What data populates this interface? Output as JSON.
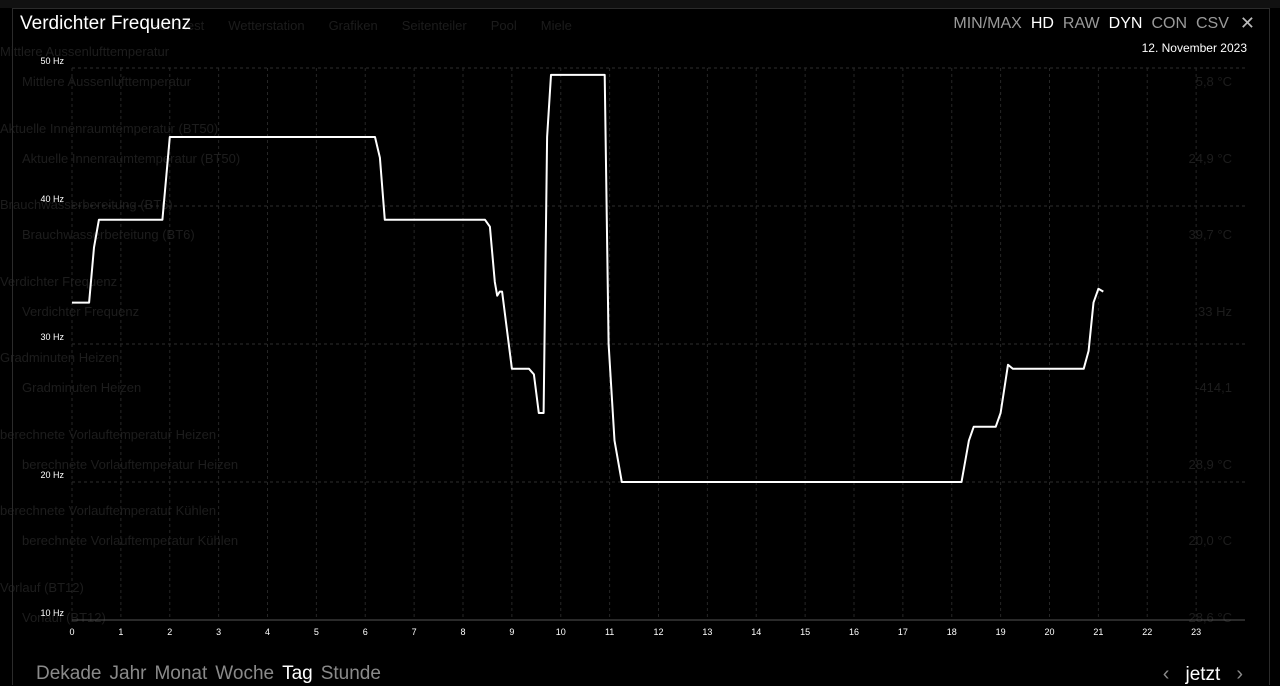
{
  "background": {
    "tabs": [
      "Hello test",
      "Wetterstation",
      "Grafiken",
      "Seitenteiler",
      "Pool",
      "Miele"
    ],
    "rows": [
      {
        "title": "Mittlere Aussenlufttemperatur",
        "label": "Mittlere Aussenlufttemperatur",
        "value": "5,8 °C"
      },
      {
        "title": "Aktuelle Innenraumtemperatur (BT50)",
        "label": "Aktuelle Innenraumtemperatur (BT50)",
        "value": "24,9 °C"
      },
      {
        "title": "Brauchwasserbereitung (BT6)",
        "label": "Brauchwasserbereitung (BT6)",
        "value": "39,7 °C"
      },
      {
        "title": "Verdichter Frequenz",
        "label": "Verdichter Frequenz",
        "value": "33 Hz"
      },
      {
        "title": "Gradminuten Heizen",
        "label": "Gradminuten Heizen",
        "value": "-414,1"
      },
      {
        "title": "berechnete Vorlauftemperatur Heizen",
        "label": "berechnete Vorlauftemperatur Heizen",
        "value": "28,9 °C"
      },
      {
        "title": "berechnete Vorlauftemperatur Kühlen",
        "label": "berechnete Vorlauftemperatur Kühlen",
        "value": "20,0 °C"
      },
      {
        "title": "Vorlauf (BT12)",
        "label": "Vorlauf (BT12)",
        "value": "28,6 °C"
      }
    ]
  },
  "modal": {
    "title": "Verdichter Frequenz",
    "date": "12. November 2023",
    "toolbar": [
      {
        "label": "MIN/MAX",
        "active": false
      },
      {
        "label": "HD",
        "active": true
      },
      {
        "label": "RAW",
        "active": false
      },
      {
        "label": "DYN",
        "active": true
      },
      {
        "label": "CON",
        "active": false
      },
      {
        "label": "CSV",
        "active": false
      }
    ],
    "close_icon": "close-icon",
    "ranges": [
      {
        "label": "Dekade",
        "active": false
      },
      {
        "label": "Jahr",
        "active": false
      },
      {
        "label": "Monat",
        "active": false
      },
      {
        "label": "Woche",
        "active": false
      },
      {
        "label": "Tag",
        "active": true
      },
      {
        "label": "Stunde",
        "active": false
      }
    ],
    "nav": {
      "prev_icon": "chevron-left-icon",
      "now_label": "jetzt",
      "next_icon": "chevron-right-icon"
    }
  },
  "chart_data": {
    "type": "line",
    "title": "Verdichter Frequenz",
    "xlabel": "",
    "ylabel": "",
    "xlim": [
      0,
      24
    ],
    "ylim": [
      10,
      50
    ],
    "x_ticks": [
      "0",
      "1",
      "2",
      "3",
      "4",
      "5",
      "6",
      "7",
      "8",
      "9",
      "10",
      "11",
      "12",
      "13",
      "14",
      "15",
      "16",
      "17",
      "18",
      "19",
      "20",
      "21",
      "22",
      "23"
    ],
    "y_ticks": [
      {
        "value": 10,
        "label": "10 Hz"
      },
      {
        "value": 20,
        "label": "20 Hz"
      },
      {
        "value": 30,
        "label": "30 Hz"
      },
      {
        "value": 40,
        "label": "40 Hz"
      },
      {
        "value": 50,
        "label": "50 Hz"
      }
    ],
    "grid": true,
    "line_color": "#ffffff",
    "series": [
      {
        "x": [
          0,
          0.35,
          0.45,
          0.55,
          1.85,
          2.0,
          6.2,
          6.3,
          6.4,
          8.45,
          8.55,
          8.65,
          8.7,
          8.75,
          8.8,
          8.9,
          9.0,
          9.35,
          9.45,
          9.55,
          9.65,
          9.72,
          9.8,
          10.9,
          10.98,
          11.1,
          11.25,
          18.2,
          18.35,
          18.45,
          18.9,
          19.0,
          19.15,
          19.25,
          20.7,
          20.8,
          20.9,
          21.0,
          21.1
        ],
        "y": [
          33,
          33,
          37,
          39,
          39,
          45,
          45,
          43.5,
          39,
          39,
          38.5,
          34.5,
          33.5,
          33.8,
          33.8,
          31,
          28.2,
          28.2,
          27.8,
          25,
          25,
          45,
          49.5,
          49.5,
          30,
          23,
          20,
          20,
          23,
          24,
          24,
          25,
          28.5,
          28.2,
          28.2,
          29.5,
          33,
          34,
          33.8
        ]
      }
    ]
  }
}
